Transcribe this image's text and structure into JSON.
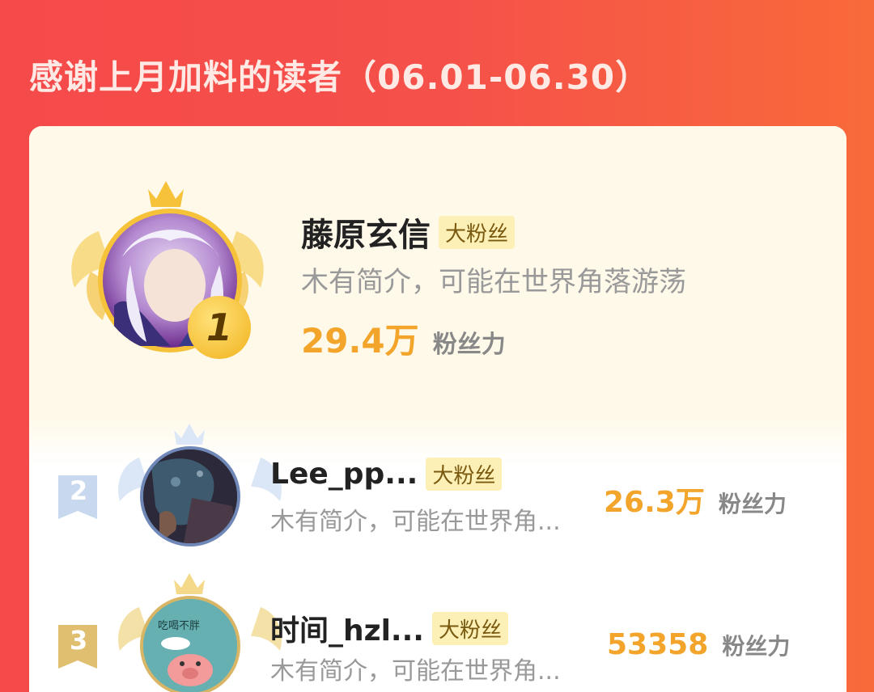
{
  "page_title": "感谢上月加料的读者（06.01-06.30）",
  "readers": [
    {
      "rank": "1",
      "name": "藤原玄信",
      "badge": "大粉丝",
      "bio": "木有简介，可能在世界角落游荡",
      "fans_value": "29.4万",
      "fans_label": "粉丝力"
    },
    {
      "rank": "2",
      "name": "Lee_pp...",
      "badge": "大粉丝",
      "bio": "木有简介，可能在世界角...",
      "fans_value": "26.3万",
      "fans_label": "粉丝力"
    },
    {
      "rank": "3",
      "name": "时间_hzl...",
      "badge": "大粉丝",
      "bio": "木有简介，可能在世界角...",
      "fans_value": "53358",
      "fans_label": "粉丝力"
    }
  ],
  "avatar_texts": {
    "rank3_caption": "吃喝不胖"
  },
  "colors": {
    "background_start": "#f54a4a",
    "background_end": "#f86a3a",
    "fans_value": "#f2a52a",
    "badge_bg": "#fdf0b6",
    "gold": "#f5c23a",
    "silver": "#c8d8ee",
    "bronze": "#e0c070"
  }
}
